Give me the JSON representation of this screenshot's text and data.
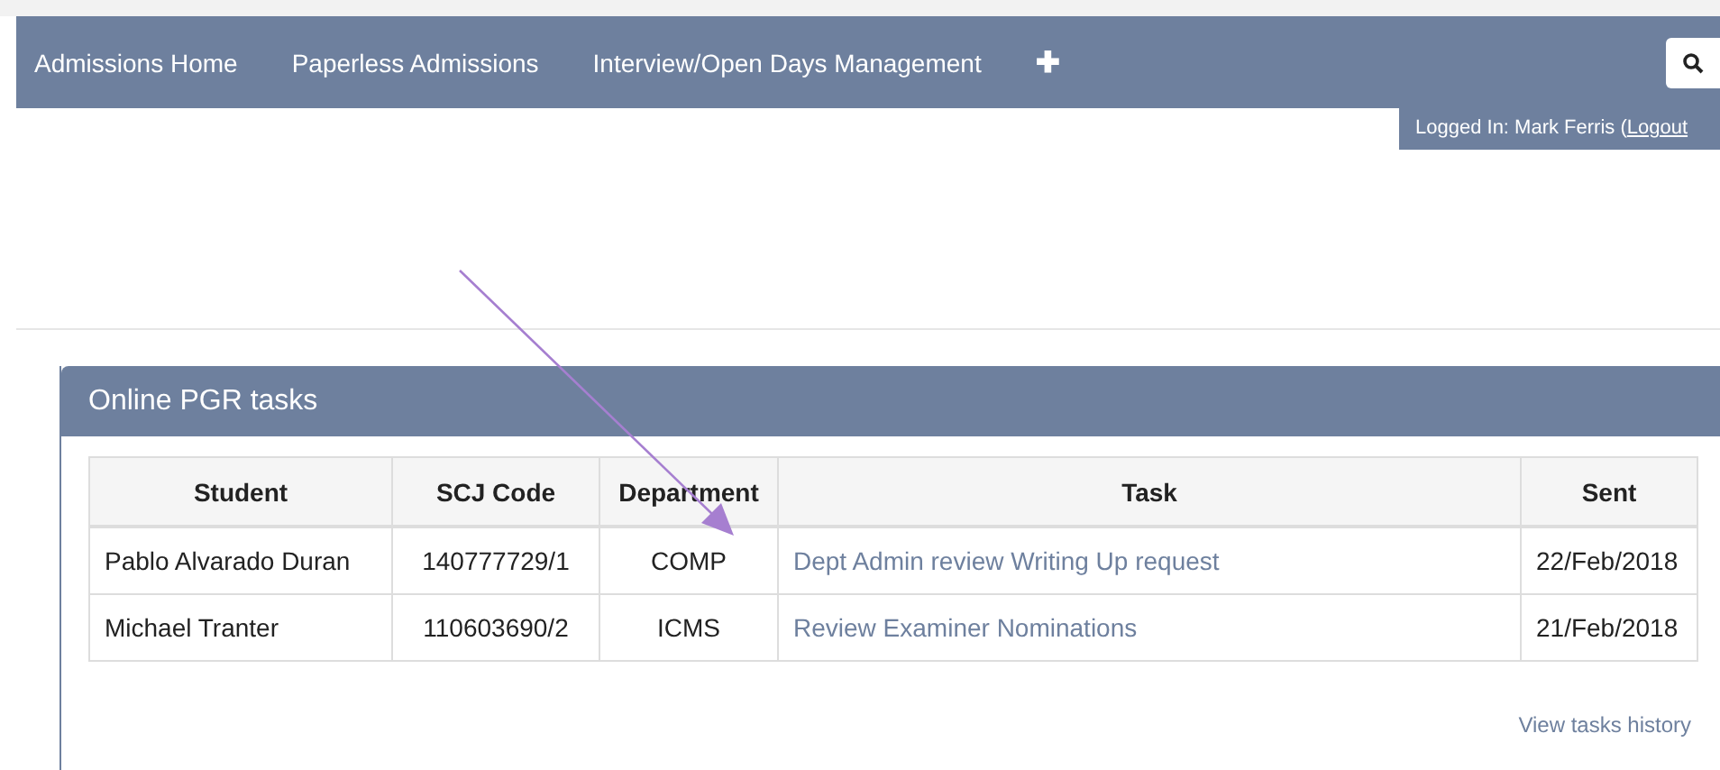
{
  "nav": {
    "items": [
      {
        "label": "Admissions Home"
      },
      {
        "label": "Paperless Admissions"
      },
      {
        "label": "Interview/Open Days Management"
      }
    ],
    "add_symbol": "✚"
  },
  "login": {
    "text": "Logged In: Mark Ferris (",
    "link": "Logout"
  },
  "panel": {
    "title": "Online PGR tasks",
    "table": {
      "columns": [
        "Student",
        "SCJ Code",
        "Department",
        "Task",
        "Sent"
      ],
      "rows": [
        {
          "student": "Pablo Alvarado Duran",
          "scj_code": "140777729/1",
          "department": "COMP",
          "task": "Dept Admin review Writing Up request",
          "sent": "22/Feb/2018"
        },
        {
          "student": "Michael Tranter",
          "scj_code": "110603690/2",
          "department": "ICMS",
          "task": "Review Examiner Nominations",
          "sent": "21/Feb/2018"
        }
      ]
    },
    "history_link": "View tasks history"
  }
}
